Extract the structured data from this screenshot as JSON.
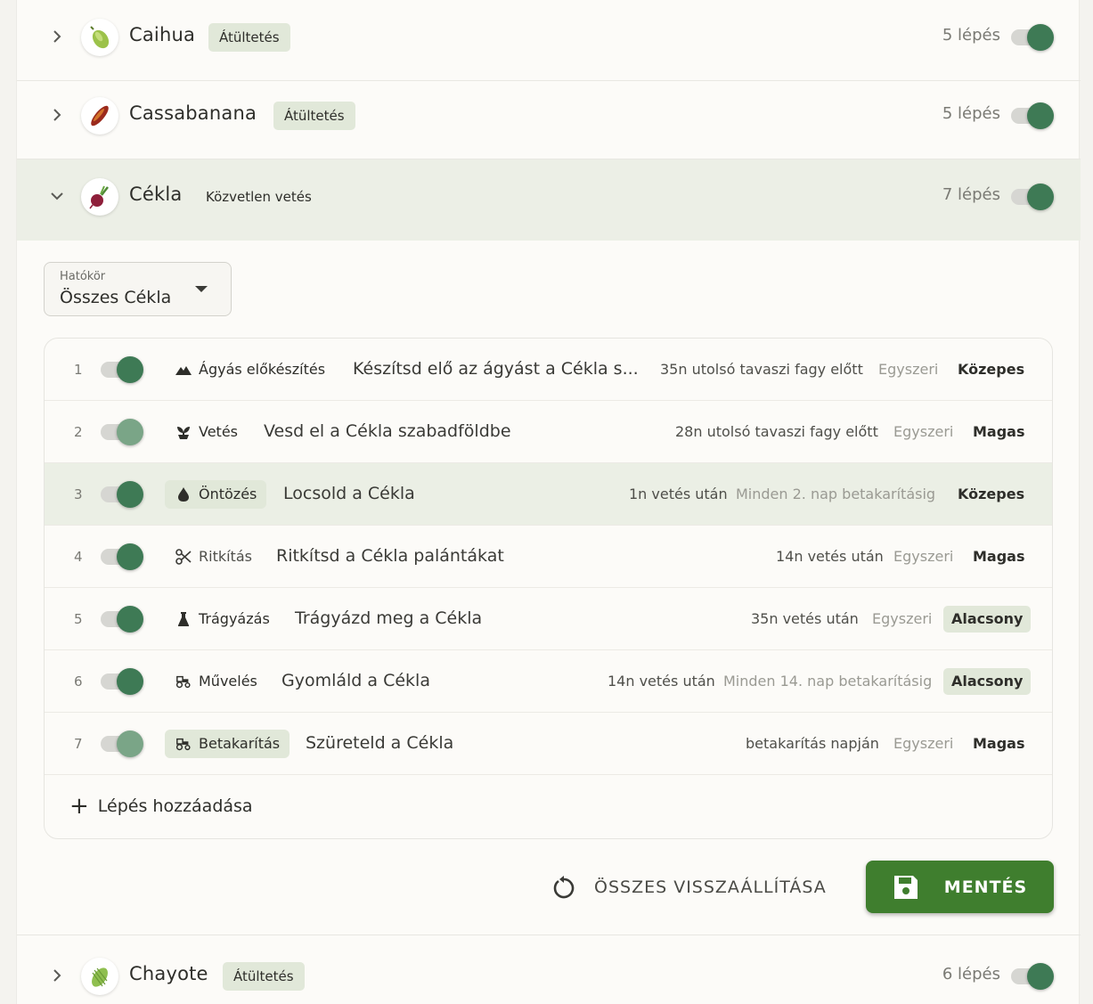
{
  "crops": [
    {
      "name": "Caihua",
      "method": "Átültetés",
      "steps": "5 lépés",
      "icon": "caihua-icon",
      "enabled": true
    },
    {
      "name": "Cassabanana",
      "method": "Átültetés",
      "steps": "5 lépés",
      "icon": "cassabanana-icon",
      "enabled": true
    },
    {
      "name": "Cékla",
      "method": "Közvetlen vetés",
      "steps": "7 lépés",
      "icon": "beet-icon",
      "enabled": true
    },
    {
      "name": "Chayote",
      "method": "Átültetés",
      "steps": "6 lépés",
      "icon": "chayote-icon",
      "enabled": true
    }
  ],
  "scope": {
    "label": "Hatókör",
    "value": "Összes Cékla"
  },
  "steps": [
    {
      "num": "1",
      "type": "Ágyás előkészítés",
      "type_icon": "mountain-icon",
      "title": "Készítsd elő az ágyást a Cékla s...",
      "timing": "35n utolsó tavaszi fagy előtt",
      "freq": "Egyszeri",
      "priority": "Közepes",
      "enabled": true
    },
    {
      "num": "2",
      "type": "Vetés",
      "type_icon": "seedling-icon",
      "title": "Vesd el a Cékla szabadföldbe",
      "timing": "28n utolsó tavaszi fagy előtt",
      "freq": "Egyszeri",
      "priority": "Magas",
      "enabled": true
    },
    {
      "num": "3",
      "type": "Öntözés",
      "type_icon": "water-drop-icon",
      "title": "Locsold a Cékla",
      "timing": "1n vetés után",
      "freq": "Minden 2. nap betakarításig",
      "priority": "Közepes",
      "enabled": true
    },
    {
      "num": "4",
      "type": "Ritkítás",
      "type_icon": "scissors-icon",
      "title": "Ritkítsd a Cékla palántákat",
      "timing": "14n vetés után",
      "freq": "Egyszeri",
      "priority": "Magas",
      "enabled": true
    },
    {
      "num": "5",
      "type": "Trágyázás",
      "type_icon": "flask-icon",
      "title": "Trágyázd meg a Cékla",
      "timing": "35n vetés után",
      "freq": "Egyszeri",
      "priority": "Alacsony",
      "enabled": true
    },
    {
      "num": "6",
      "type": "Művelés",
      "type_icon": "tractor-icon",
      "title": "Gyomláld a Cékla",
      "timing": "14n vetés után",
      "freq": "Minden 14. nap betakarításig",
      "priority": "Alacsony",
      "enabled": true
    },
    {
      "num": "7",
      "type": "Betakarítás",
      "type_icon": "tractor-icon",
      "title": "Szüreteld a Cékla",
      "timing": "betakarítás napján",
      "freq": "Egyszeri",
      "priority": "Magas",
      "enabled": true
    }
  ],
  "add_step_label": "Lépés hozzáadása",
  "reset_label": "ÖSSZES VISSZAÁLLÍTÁSA",
  "save_label": "MENTÉS",
  "colors": {
    "accent": "#3e7a55",
    "save": "#3f7e2e",
    "highlight": "#ebefe5",
    "badge": "#e1e8d9"
  }
}
